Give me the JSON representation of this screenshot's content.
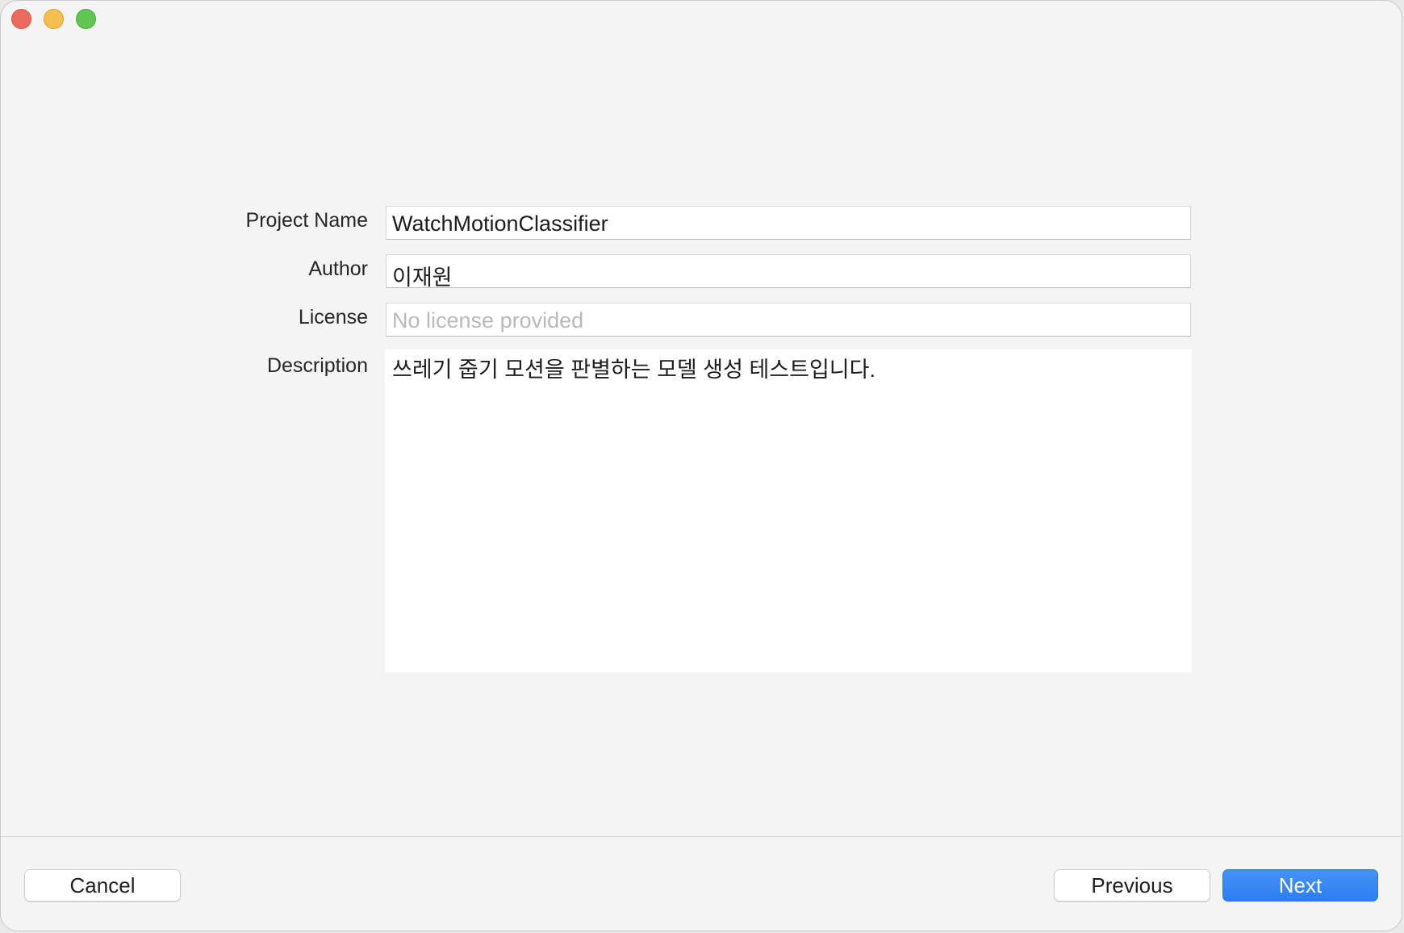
{
  "window": {
    "controls": {
      "close": "close-button",
      "minimize": "minimize-button",
      "zoom": "zoom-button"
    }
  },
  "form": {
    "project_name": {
      "label": "Project Name",
      "value": "WatchMotionClassifier"
    },
    "author": {
      "label": "Author",
      "value": "이재원"
    },
    "license": {
      "label": "License",
      "value": "",
      "placeholder": "No license provided"
    },
    "description": {
      "label": "Description",
      "value": "쓰레기 줍기 모션을 판별하는 모델 생성 테스트입니다."
    }
  },
  "footer": {
    "cancel_label": "Cancel",
    "previous_label": "Previous",
    "next_label": "Next"
  },
  "colors": {
    "accent": "#2d7ef3",
    "window_bg": "#f3f4f3"
  }
}
